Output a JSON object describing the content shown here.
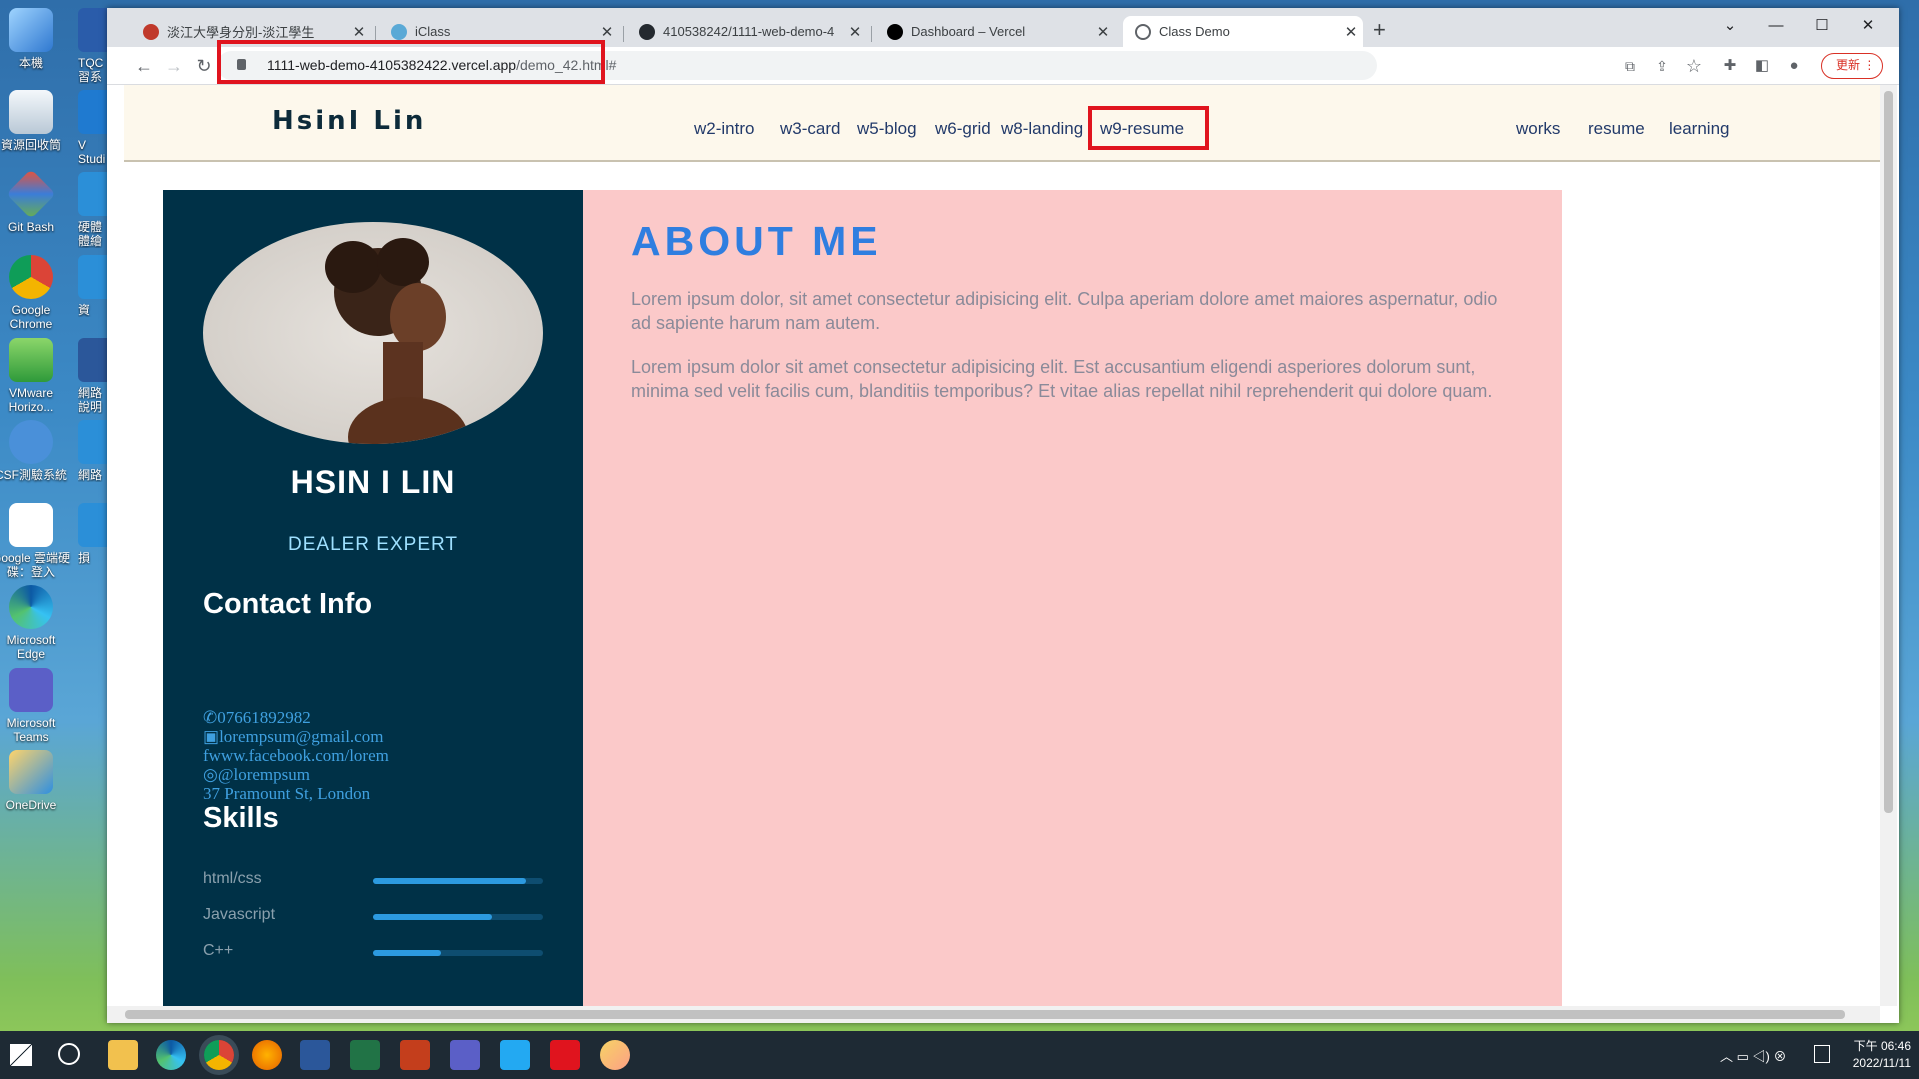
{
  "desktop": {
    "icons": [
      {
        "label": "本機"
      },
      {
        "label": "資源回收筒"
      },
      {
        "label": "Git Bash"
      },
      {
        "label": "Google Chrome"
      },
      {
        "label": "VMware Horizo..."
      },
      {
        "label": "CSF測驗系統"
      },
      {
        "label": "Google 雲端硬碟：登入"
      },
      {
        "label": "Microsoft Edge"
      },
      {
        "label": "Microsoft Teams"
      },
      {
        "label": "OneDrive"
      }
    ],
    "icons_col2": [
      {
        "label": "TQC 習系"
      },
      {
        "label": "V Studi"
      },
      {
        "label": "硬體 體繪"
      },
      {
        "label": "資"
      },
      {
        "label": "網路 說明"
      },
      {
        "label": "網路"
      },
      {
        "label": "損"
      }
    ]
  },
  "browser": {
    "tabs": [
      {
        "title": "淡江大學身分別-淡江學生",
        "active": false
      },
      {
        "title": "iClass",
        "active": false
      },
      {
        "title": "410538242/1111-web-demo-4",
        "active": false
      },
      {
        "title": "Dashboard – Vercel",
        "active": false
      },
      {
        "title": "Class Demo",
        "active": true
      }
    ],
    "new_tab": "+",
    "url_host": "1111-web-demo-4105382422.vercel.app",
    "url_path": "/demo_42.html#",
    "update_label": "更新"
  },
  "site": {
    "brand": "HsinI Lin",
    "nav_links": [
      "w2-intro",
      "w3-card",
      "w5-blog",
      "w6-grid",
      "w8-landing",
      "w9-resume"
    ],
    "nav_right": [
      "works",
      "resume",
      "learning"
    ],
    "profile": {
      "name": "HSIN I LIN",
      "role": "DEALER EXPERT"
    },
    "contact_heading": "Contact Info",
    "contact": {
      "phone": "07661892982",
      "email": "lorempsum@gmail.com",
      "facebook": "www.facebook.com/lorem",
      "instagram": "@lorempsum",
      "address": "37 Pramount St, London"
    },
    "skills_heading": "Skills",
    "skills": [
      {
        "name": "html/css",
        "level": 0.9
      },
      {
        "name": "Javascript",
        "level": 0.7
      },
      {
        "name": "C++",
        "level": 0.4
      }
    ],
    "about_title": "ABOUT ME",
    "about_p1": "Lorem ipsum dolor, sit amet consectetur adipisicing elit. Culpa aperiam dolore amet maiores aspernatur, odio ad sapiente harum nam autem.",
    "about_p2": "Lorem ipsum dolor sit amet consectetur adipisicing elit. Est accusantium eligendi asperiores dolorum sunt, minima sed velit facilis cum, blanditiis temporibus? Et vitae alias repellat nihil reprehenderit qui dolore quam."
  },
  "taskbar": {
    "time": "下午 06:46",
    "date": "2022/11/11"
  },
  "colors": {
    "sidebar": "#003147",
    "main": "#fbc9c9",
    "accent": "#2f7ee0",
    "highlight_box": "#e0141e"
  }
}
